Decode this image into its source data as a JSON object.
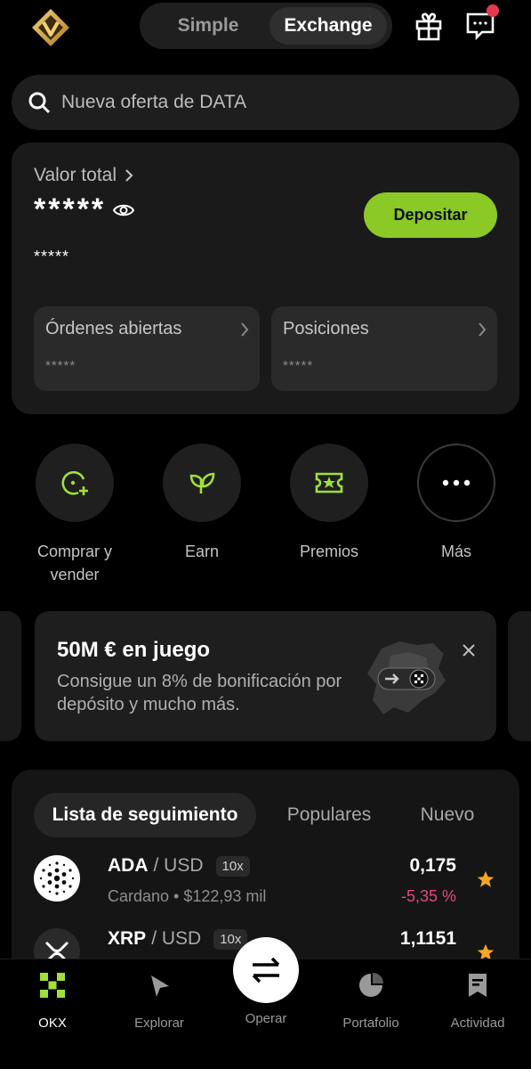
{
  "header": {
    "mode_simple": "Simple",
    "mode_exchange": "Exchange",
    "accent": "#8ac926"
  },
  "search": {
    "placeholder": "Nueva oferta de DATA"
  },
  "balance": {
    "label": "Valor total",
    "value_hidden": "*****",
    "sub_hidden": "*****",
    "deposit_label": "Depositar",
    "open_orders_label": "Órdenes abiertas",
    "open_orders_value": "*****",
    "positions_label": "Posiciones",
    "positions_value": "*****"
  },
  "actions": [
    {
      "label": "Comprar y vender",
      "icon": "buy-sell-icon"
    },
    {
      "label": "Earn",
      "icon": "earn-leaf-icon"
    },
    {
      "label": "Premios",
      "icon": "rewards-ticket-icon"
    },
    {
      "label": "Más",
      "icon": "more-dots-icon"
    }
  ],
  "promo": {
    "title": "50M € en juego",
    "desc": "Consigue un 8% de bonificación por depósito y mucho más."
  },
  "watchlist": {
    "tabs": [
      "Lista de seguimiento",
      "Populares",
      "Nuevo"
    ],
    "rows": [
      {
        "base": "ADA",
        "quote": "/ USD",
        "leverage": "10x",
        "meta": "Cardano • $122,93 mil",
        "price": "0,175",
        "change": "-5,35 %"
      },
      {
        "base": "XRP",
        "quote": "/ USD",
        "leverage": "10x",
        "meta": "",
        "price": "1,1151",
        "change": ""
      }
    ]
  },
  "nav": {
    "items": [
      "OKX",
      "Explorar",
      "Operar",
      "Portafolio",
      "Actividad"
    ]
  }
}
